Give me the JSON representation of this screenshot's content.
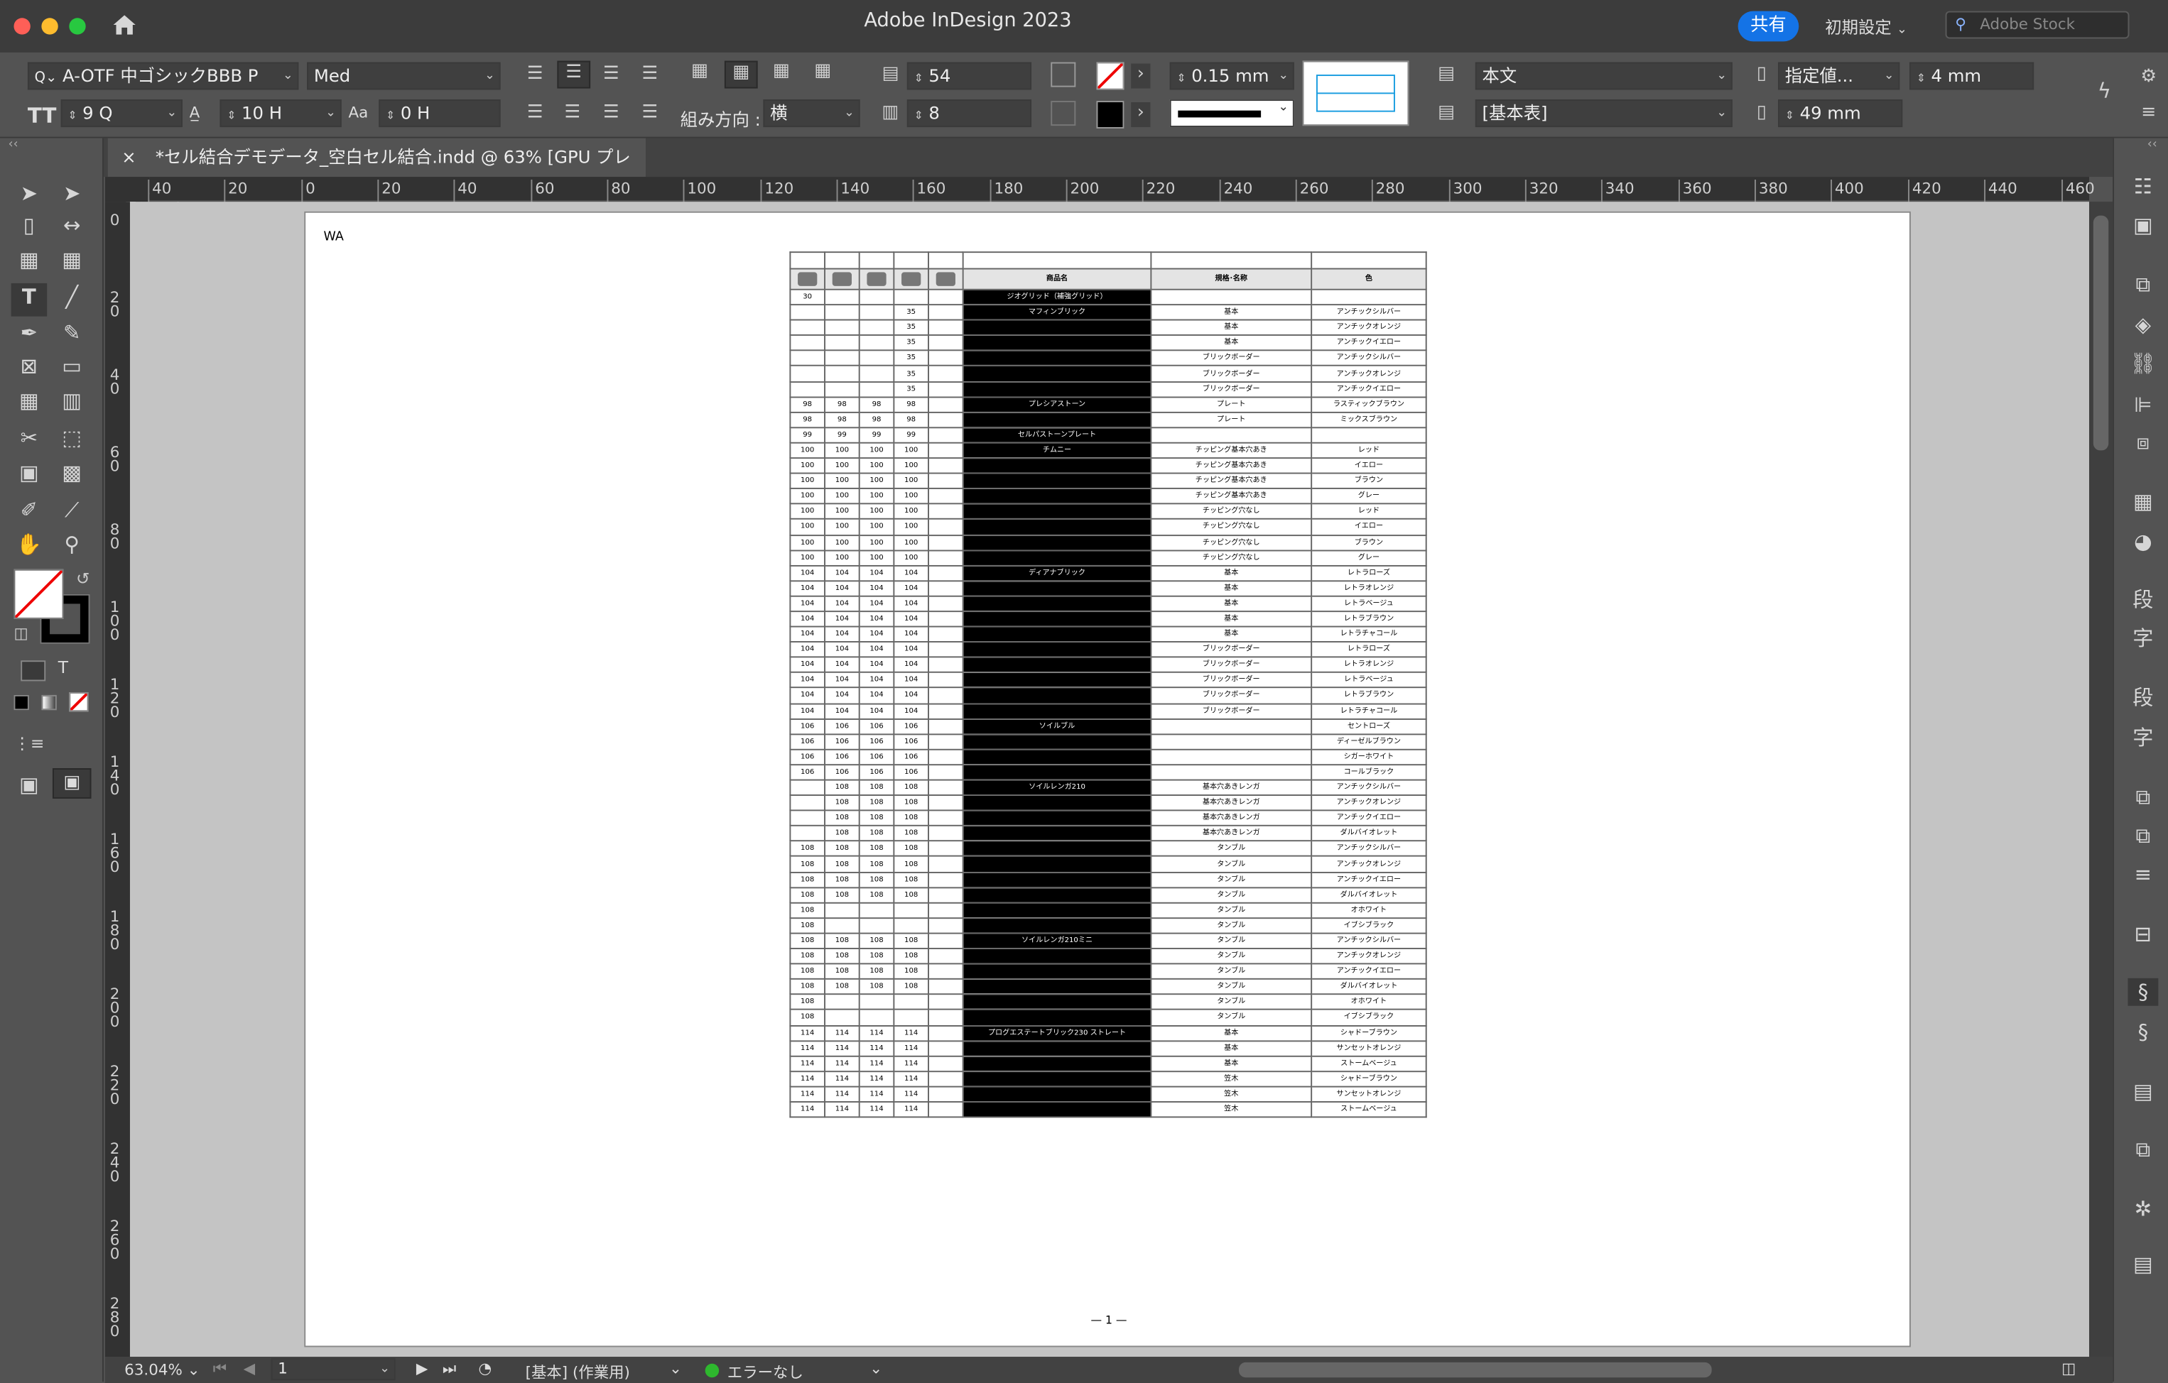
{
  "app": {
    "title": "Adobe InDesign 2023",
    "share_label": "共有",
    "workspace_label": "初期設定",
    "stock_placeholder": "Adobe Stock"
  },
  "control": {
    "font_family": "A-OTF 中ゴシックBBB P",
    "font_style": "Med",
    "font_size": "9 Q",
    "leading": "10 H",
    "tracking": "0 H",
    "direction_label": "組み方向 :",
    "direction_value": "横",
    "rows": "54",
    "cols": "8",
    "stroke_weight": "0.15 mm",
    "paragraph_style": "本文",
    "table_style": "[基本表]",
    "row_height_mode": "指定値...",
    "row_height": "4 mm",
    "col_width": "49 mm"
  },
  "tab": {
    "close": "×",
    "title": "*セル結合デモデータ_空白セル結合.indd @ 63% [GPU プレビュー]"
  },
  "ruler": {
    "h_ticks": [
      "40",
      "20",
      "0",
      "20",
      "40",
      "60",
      "80",
      "100",
      "120",
      "140",
      "160",
      "180",
      "200",
      "220",
      "240",
      "260",
      "280",
      "300",
      "320",
      "340",
      "360",
      "380",
      "400",
      "420",
      "440",
      "460"
    ],
    "v_ticks": [
      "0",
      "20",
      "40",
      "60",
      "80",
      "100",
      "120",
      "140",
      "160",
      "180",
      "200",
      "220",
      "240",
      "260",
      "280"
    ]
  },
  "page": {
    "corner_label": "WA",
    "folio": "— 1 —"
  },
  "table": {
    "headers": [
      "商品名",
      "規格･名称",
      "色"
    ],
    "rows": [
      [
        "30",
        "",
        "",
        "",
        "",
        "ジオグリッド（補強グリッド）",
        "",
        ""
      ],
      [
        "",
        "",
        "",
        "35",
        "",
        "マフィンブリック",
        "基本",
        "アンチックシルバー"
      ],
      [
        "",
        "",
        "",
        "35",
        "",
        "",
        "基本",
        "アンチックオレンジ"
      ],
      [
        "",
        "",
        "",
        "35",
        "",
        "",
        "基本",
        "アンチックイエロー"
      ],
      [
        "",
        "",
        "",
        "35",
        "",
        "",
        "ブリックボーダー",
        "アンチックシルバー"
      ],
      [
        "",
        "",
        "",
        "35",
        "",
        "",
        "ブリックボーダー",
        "アンチックオレンジ"
      ],
      [
        "",
        "",
        "",
        "35",
        "",
        "",
        "ブリックボーダー",
        "アンチックイエロー"
      ],
      [
        "98",
        "98",
        "98",
        "98",
        "",
        "プレシアストーン",
        "プレート",
        "ラスティックブラウン"
      ],
      [
        "98",
        "98",
        "98",
        "98",
        "",
        "",
        "プレート",
        "ミックスブラウン"
      ],
      [
        "99",
        "99",
        "99",
        "99",
        "",
        "セルパストーンプレート",
        "",
        ""
      ],
      [
        "100",
        "100",
        "100",
        "100",
        "",
        "チムニー",
        "チッピング基本穴あき",
        "レッド"
      ],
      [
        "100",
        "100",
        "100",
        "100",
        "",
        "",
        "チッピング基本穴あき",
        "イエロー"
      ],
      [
        "100",
        "100",
        "100",
        "100",
        "",
        "",
        "チッピング基本穴あき",
        "ブラウン"
      ],
      [
        "100",
        "100",
        "100",
        "100",
        "",
        "",
        "チッピング基本穴あき",
        "グレー"
      ],
      [
        "100",
        "100",
        "100",
        "100",
        "",
        "",
        "チッピング穴なし",
        "レッド"
      ],
      [
        "100",
        "100",
        "100",
        "100",
        "",
        "",
        "チッピング穴なし",
        "イエロー"
      ],
      [
        "100",
        "100",
        "100",
        "100",
        "",
        "",
        "チッピング穴なし",
        "ブラウン"
      ],
      [
        "100",
        "100",
        "100",
        "100",
        "",
        "",
        "チッピング穴なし",
        "グレー"
      ],
      [
        "104",
        "104",
        "104",
        "104",
        "",
        "ディアナブリック",
        "基本",
        "レトラローズ"
      ],
      [
        "104",
        "104",
        "104",
        "104",
        "",
        "",
        "基本",
        "レトラオレンジ"
      ],
      [
        "104",
        "104",
        "104",
        "104",
        "",
        "",
        "基本",
        "レトラベージュ"
      ],
      [
        "104",
        "104",
        "104",
        "104",
        "",
        "",
        "基本",
        "レトラブラウン"
      ],
      [
        "104",
        "104",
        "104",
        "104",
        "",
        "",
        "基本",
        "レトラチャコール"
      ],
      [
        "104",
        "104",
        "104",
        "104",
        "",
        "",
        "ブリックボーダー",
        "レトラローズ"
      ],
      [
        "104",
        "104",
        "104",
        "104",
        "",
        "",
        "ブリックボーダー",
        "レトラオレンジ"
      ],
      [
        "104",
        "104",
        "104",
        "104",
        "",
        "",
        "ブリックボーダー",
        "レトラベージュ"
      ],
      [
        "104",
        "104",
        "104",
        "104",
        "",
        "",
        "ブリックボーダー",
        "レトラブラウン"
      ],
      [
        "104",
        "104",
        "104",
        "104",
        "",
        "",
        "ブリックボーダー",
        "レトラチャコール"
      ],
      [
        "106",
        "106",
        "106",
        "106",
        "",
        "ソイルブル",
        "",
        "セントローズ"
      ],
      [
        "106",
        "106",
        "106",
        "106",
        "",
        "",
        "",
        "ディーゼルブラウン"
      ],
      [
        "106",
        "106",
        "106",
        "106",
        "",
        "",
        "",
        "シガーホワイト"
      ],
      [
        "106",
        "106",
        "106",
        "106",
        "",
        "",
        "",
        "コールブラック"
      ],
      [
        "",
        "108",
        "108",
        "108",
        "",
        "ソイルレンガ210",
        "基本穴あきレンガ",
        "アンチックシルバー"
      ],
      [
        "",
        "108",
        "108",
        "108",
        "",
        "",
        "基本穴あきレンガ",
        "アンチックオレンジ"
      ],
      [
        "",
        "108",
        "108",
        "108",
        "",
        "",
        "基本穴あきレンガ",
        "アンチックイエロー"
      ],
      [
        "",
        "108",
        "108",
        "108",
        "",
        "",
        "基本穴あきレンガ",
        "ダルバイオレット"
      ],
      [
        "108",
        "108",
        "108",
        "108",
        "",
        "",
        "タンブル",
        "アンチックシルバー"
      ],
      [
        "108",
        "108",
        "108",
        "108",
        "",
        "",
        "タンブル",
        "アンチックオレンジ"
      ],
      [
        "108",
        "108",
        "108",
        "108",
        "",
        "",
        "タンブル",
        "アンチックイエロー"
      ],
      [
        "108",
        "108",
        "108",
        "108",
        "",
        "",
        "タンブル",
        "ダルバイオレット"
      ],
      [
        "108",
        "",
        "",
        "",
        "",
        "",
        "タンブル",
        "オホワイト"
      ],
      [
        "108",
        "",
        "",
        "",
        "",
        "",
        "タンブル",
        "イブシブラック"
      ],
      [
        "108",
        "108",
        "108",
        "108",
        "",
        "ソイルレンガ210ミニ",
        "タンブル",
        "アンチックシルバー"
      ],
      [
        "108",
        "108",
        "108",
        "108",
        "",
        "",
        "タンブル",
        "アンチックオレンジ"
      ],
      [
        "108",
        "108",
        "108",
        "108",
        "",
        "",
        "タンブル",
        "アンチックイエロー"
      ],
      [
        "108",
        "108",
        "108",
        "108",
        "",
        "",
        "タンブル",
        "ダルバイオレット"
      ],
      [
        "108",
        "",
        "",
        "",
        "",
        "",
        "タンブル",
        "オホワイト"
      ],
      [
        "108",
        "",
        "",
        "",
        "",
        "",
        "タンブル",
        "イブシブラック"
      ],
      [
        "114",
        "114",
        "114",
        "114",
        "",
        "プログエステートブリック230 ストレート",
        "基本",
        "シャドーブラウン"
      ],
      [
        "114",
        "114",
        "114",
        "114",
        "",
        "",
        "基本",
        "サンセットオレンジ"
      ],
      [
        "114",
        "114",
        "114",
        "114",
        "",
        "",
        "基本",
        "ストームベージュ"
      ],
      [
        "114",
        "114",
        "114",
        "114",
        "",
        "",
        "笠木",
        "シャドーブラウン"
      ],
      [
        "114",
        "114",
        "114",
        "114",
        "",
        "",
        "笠木",
        "サンセットオレンジ"
      ],
      [
        "114",
        "114",
        "114",
        "114",
        "",
        "",
        "笠木",
        "ストームベージュ"
      ]
    ]
  },
  "status": {
    "zoom": "63.04%",
    "page_num": "1",
    "master": "[基本] (作業用)",
    "preflight": "エラーなし"
  },
  "colors": {
    "accent": "#1473e6",
    "ok": "#2eb82e",
    "cell_black": "#000000"
  }
}
